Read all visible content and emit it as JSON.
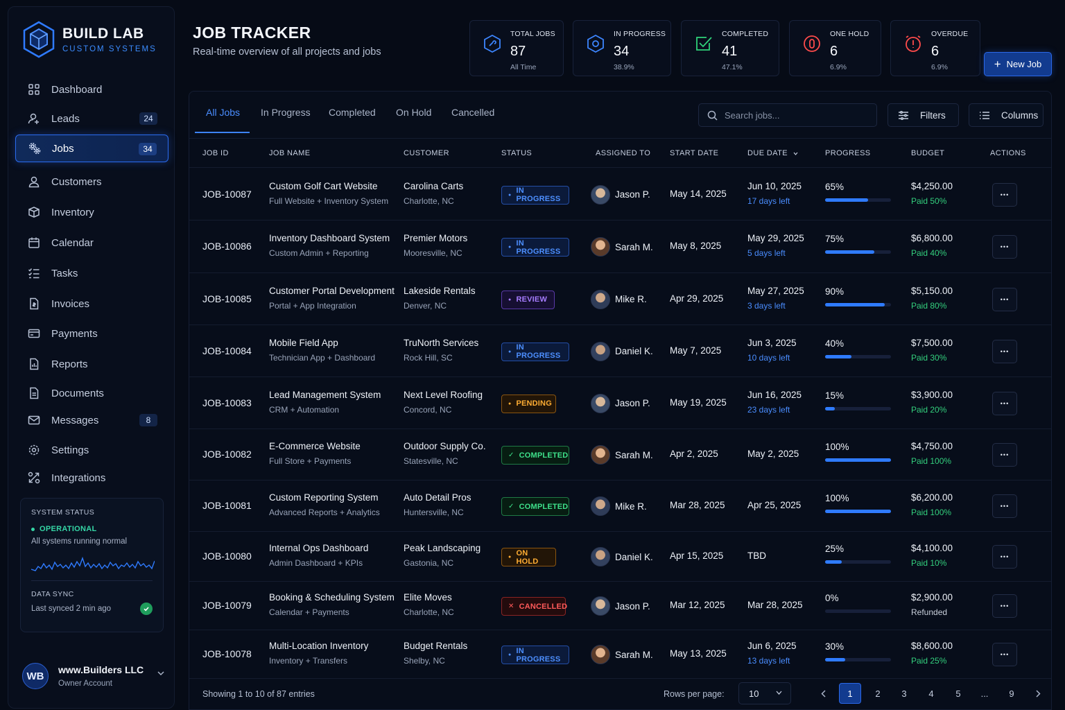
{
  "brand": {
    "name": "BUILD LAB",
    "subtitle": "CUSTOM SYSTEMS"
  },
  "sidebar": {
    "items": [
      {
        "label": "Dashboard",
        "icon": "grid-icon",
        "badge": ""
      },
      {
        "label": "Leads",
        "icon": "user-plus-icon",
        "badge": "24"
      },
      {
        "label": "Jobs",
        "icon": "gears-icon",
        "badge": "34",
        "active": true
      },
      {
        "label": "Customers",
        "icon": "user-icon",
        "badge": ""
      },
      {
        "label": "Inventory",
        "icon": "box-icon",
        "badge": ""
      },
      {
        "label": "Calendar",
        "icon": "calendar-icon",
        "badge": ""
      },
      {
        "label": "Tasks",
        "icon": "checklist-icon",
        "badge": ""
      },
      {
        "label": "Invoices",
        "icon": "invoice-icon",
        "badge": ""
      },
      {
        "label": "Payments",
        "icon": "card-icon",
        "badge": ""
      },
      {
        "label": "Reports",
        "icon": "report-icon",
        "badge": ""
      },
      {
        "label": "Documents",
        "icon": "document-icon",
        "badge": ""
      },
      {
        "label": "Messages",
        "icon": "mail-icon",
        "badge": "8"
      },
      {
        "label": "Settings",
        "icon": "gear-icon",
        "badge": ""
      },
      {
        "label": "Integrations",
        "icon": "integrations-icon",
        "badge": ""
      }
    ],
    "system_status": {
      "label": "SYSTEM STATUS",
      "state": "OPERATIONAL",
      "description": "All systems running normal",
      "sync_label": "DATA SYNC",
      "sync_text": "Last synced 2 min ago"
    },
    "account": {
      "initials": "WB",
      "name": "www.Builders LLC",
      "role": "Owner Account"
    }
  },
  "header": {
    "title": "JOB TRACKER",
    "subtitle": "Real-time overview of all projects and jobs",
    "new_job_label": "New Job"
  },
  "stats": [
    {
      "label": "TOTAL JOBS",
      "value": "87",
      "sub": "All Time",
      "icon": "hexagon-tool-icon",
      "color": "#3d86ff"
    },
    {
      "label": "IN PROGRESS",
      "value": "34",
      "sub": "38.9%",
      "icon": "hexagon-gear-icon",
      "color": "#3d86ff"
    },
    {
      "label": "COMPLETED",
      "value": "41",
      "sub": "47.1%",
      "icon": "checkbox-icon",
      "color": "#2fd27a"
    },
    {
      "label": "ONE HOLD",
      "value": "6",
      "sub": "6.9%",
      "icon": "alert-circle-icon",
      "color": "#ff4b4b"
    },
    {
      "label": "OVERDUE",
      "value": "6",
      "sub": "6.9%",
      "icon": "alarm-icon",
      "color": "#ff4b4b"
    }
  ],
  "tabs": [
    {
      "label": "All Jobs",
      "active": true
    },
    {
      "label": "In Progress"
    },
    {
      "label": "Completed"
    },
    {
      "label": "On Hold"
    },
    {
      "label": "Cancelled"
    }
  ],
  "toolbar": {
    "search_placeholder": "Search jobs...",
    "filters_label": "Filters",
    "columns_label": "Columns"
  },
  "columns": [
    "JOB ID",
    "JOB NAME",
    "CUSTOMER",
    "STATUS",
    "ASSIGNED TO",
    "START DATE",
    "DUE DATE",
    "PROGRESS",
    "BUDGET",
    "ACTIONS"
  ],
  "jobs": [
    {
      "id": "JOB-10087",
      "name": "Custom Golf Cart Website",
      "scope": "Full Website + Inventory System",
      "customer": "Carolina Carts",
      "location": "Charlotte, NC",
      "status": "IN PROGRESS",
      "status_kind": "progress",
      "assignee": "Jason P.",
      "start": "May 14, 2025",
      "due": "Jun 10, 2025",
      "due_note": "17 days left",
      "progress": 65,
      "progress_label": "65%",
      "budget": "$4,250.00",
      "paid": "Paid 50%"
    },
    {
      "id": "JOB-10086",
      "name": "Inventory Dashboard System",
      "scope": "Custom Admin + Reporting",
      "customer": "Premier Motors",
      "location": "Mooresville, NC",
      "status": "IN PROGRESS",
      "status_kind": "progress",
      "assignee": "Sarah M.",
      "start": "May 8, 2025",
      "due": "May 29, 2025",
      "due_note": "5 days left",
      "progress": 75,
      "progress_label": "75%",
      "budget": "$6,800.00",
      "paid": "Paid 40%"
    },
    {
      "id": "JOB-10085",
      "name": "Customer Portal Development",
      "scope": "Portal + App Integration",
      "customer": "Lakeside Rentals",
      "location": "Denver, NC",
      "status": "REVIEW",
      "status_kind": "review",
      "assignee": "Mike R.",
      "start": "Apr 29, 2025",
      "due": "May 27, 2025",
      "due_note": "3 days left",
      "progress": 90,
      "progress_label": "90%",
      "budget": "$5,150.00",
      "paid": "Paid 80%"
    },
    {
      "id": "JOB-10084",
      "name": "Mobile Field App",
      "scope": "Technician App + Dashboard",
      "customer": "TruNorth Services",
      "location": "Rock Hill, SC",
      "status": "IN PROGRESS",
      "status_kind": "progress",
      "assignee": "Daniel K.",
      "start": "May 7, 2025",
      "due": "Jun 3, 2025",
      "due_note": "10 days left",
      "progress": 40,
      "progress_label": "40%",
      "budget": "$7,500.00",
      "paid": "Paid 30%"
    },
    {
      "id": "JOB-10083",
      "name": "Lead Management System",
      "scope": "CRM + Automation",
      "customer": "Next Level Roofing",
      "location": "Concord, NC",
      "status": "PENDING",
      "status_kind": "pending",
      "assignee": "Jason P.",
      "start": "May 19, 2025",
      "due": "Jun 16, 2025",
      "due_note": "23 days left",
      "progress": 15,
      "progress_label": "15%",
      "budget": "$3,900.00",
      "paid": "Paid 20%"
    },
    {
      "id": "JOB-10082",
      "name": "E-Commerce Website",
      "scope": "Full Store + Payments",
      "customer": "Outdoor Supply Co.",
      "location": "Statesville, NC",
      "status": "COMPLETED",
      "status_kind": "completed",
      "assignee": "Sarah M.",
      "start": "Apr 2, 2025",
      "due": "May 2, 2025",
      "due_note": "",
      "progress": 100,
      "progress_label": "100%",
      "budget": "$4,750.00",
      "paid": "Paid 100%"
    },
    {
      "id": "JOB-10081",
      "name": "Custom Reporting System",
      "scope": "Advanced Reports + Analytics",
      "customer": "Auto Detail Pros",
      "location": "Huntersville, NC",
      "status": "COMPLETED",
      "status_kind": "completed",
      "assignee": "Mike R.",
      "start": "Mar 28, 2025",
      "due": "Apr 25, 2025",
      "due_note": "",
      "progress": 100,
      "progress_label": "100%",
      "budget": "$6,200.00",
      "paid": "Paid 100%"
    },
    {
      "id": "JOB-10080",
      "name": "Internal Ops Dashboard",
      "scope": "Admin Dashboard + KPIs",
      "customer": "Peak Landscaping",
      "location": "Gastonia, NC",
      "status": "ON HOLD",
      "status_kind": "onhold",
      "assignee": "Daniel K.",
      "start": "Apr 15, 2025",
      "due": "TBD",
      "due_note": "",
      "progress": 25,
      "progress_label": "25%",
      "budget": "$4,100.00",
      "paid": "Paid 10%"
    },
    {
      "id": "JOB-10079",
      "name": "Booking & Scheduling System",
      "scope": "Calendar + Payments",
      "customer": "Elite Moves",
      "location": "Charlotte, NC",
      "status": "CANCELLED",
      "status_kind": "cancelled",
      "assignee": "Jason P.",
      "start": "Mar 12, 2025",
      "due": "Mar 28, 2025",
      "due_note": "",
      "progress": 0,
      "progress_label": "0%",
      "budget": "$2,900.00",
      "paid": "Refunded"
    },
    {
      "id": "JOB-10078",
      "name": "Multi-Location Inventory",
      "scope": "Inventory + Transfers",
      "customer": "Budget Rentals",
      "location": "Shelby, NC",
      "status": "IN PROGRESS",
      "status_kind": "progress",
      "assignee": "Sarah M.",
      "start": "May 13, 2025",
      "due": "Jun 6, 2025",
      "due_note": "13 days left",
      "progress": 30,
      "progress_label": "30%",
      "budget": "$8,600.00",
      "paid": "Paid 25%"
    }
  ],
  "footer": {
    "showing": "Showing 1 to 10 of 87 entries",
    "rows_label": "Rows per page:",
    "rows_value": "10",
    "pages": [
      "1",
      "2",
      "3",
      "4",
      "5",
      "...",
      "9"
    ],
    "current_page": "1"
  }
}
